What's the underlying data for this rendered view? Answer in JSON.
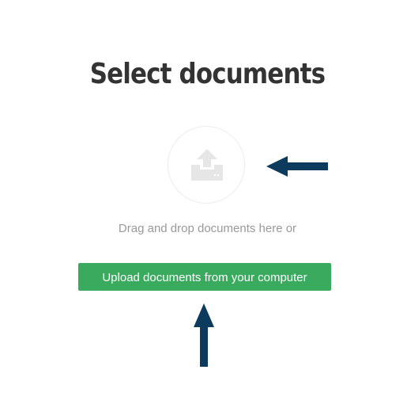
{
  "heading": {
    "title": "Select documents"
  },
  "dropzone": {
    "icon": "upload-tray-icon",
    "instruction": "Drag and drop documents here or"
  },
  "upload": {
    "button_label": "Upload documents from your computer"
  },
  "colors": {
    "button_background": "#3aaa5f",
    "arrow": "#0d3b5e",
    "icon": "#e6e6e6"
  }
}
